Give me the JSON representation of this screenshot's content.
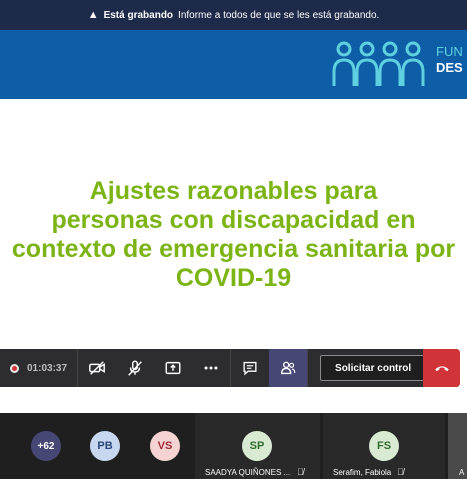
{
  "recording": {
    "bold": "Está grabando",
    "message": "Informe a todos de que se les está grabando."
  },
  "logo": {
    "line1": "FUN",
    "line2": "DES"
  },
  "slide": {
    "title_lines": [
      "Ajustes razonables para",
      "personas con discapacidad en",
      "contexto de emergencia sanitaria por",
      "COVID-19"
    ],
    "title_color": "#7cb416"
  },
  "toolbar": {
    "timer": "01:03:37",
    "request_control": "Solicitar control",
    "icons": [
      "video-off-icon",
      "mic-off-icon",
      "share-icon",
      "more-icon",
      "chat-icon",
      "participants-icon",
      "hangup-icon"
    ]
  },
  "participants": {
    "overflow": "+62",
    "avatars": [
      {
        "initials": "PB",
        "bg": "#c7d7f0",
        "fg": "#27457a"
      },
      {
        "initials": "VS",
        "bg": "#f6d3d3",
        "fg": "#a02d35"
      }
    ],
    "tiles": [
      {
        "initials": "SP",
        "name": "SAADYA QUIÑONES ...",
        "bg": "#d9ead3",
        "fg": "#2e6b2e"
      },
      {
        "initials": "FS",
        "name": "Serafim, Fabiola",
        "bg": "#d9ead3",
        "fg": "#2e6b2e"
      }
    ],
    "last_label": "A"
  },
  "colors": {
    "header_bar": "#1e2a4a",
    "brand_blue": "#0d5ea6",
    "hangup": "#d13438",
    "toolbar_bg": "#2d2d30"
  }
}
